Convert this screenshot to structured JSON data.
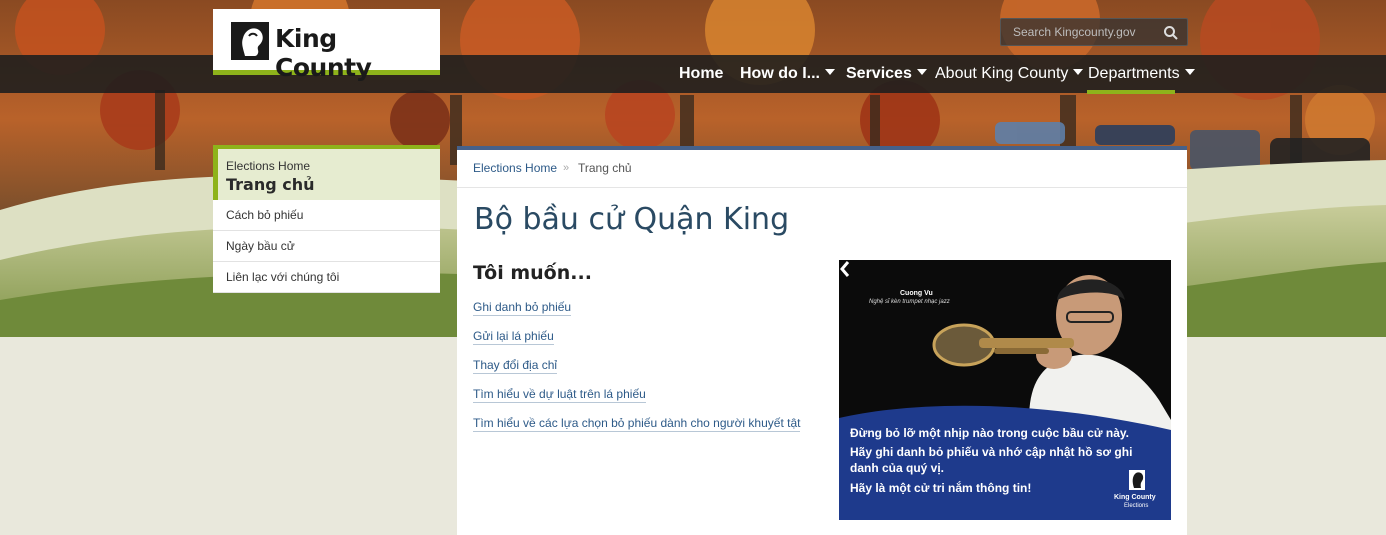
{
  "header": {
    "logo_text": "King County",
    "search_placeholder": "Search Kingcounty.gov",
    "nav": [
      {
        "label": "Home"
      },
      {
        "label": "How do I..."
      },
      {
        "label": "Services"
      },
      {
        "label": "About King County"
      },
      {
        "label": "Departments"
      }
    ]
  },
  "sidebar": {
    "parent": "Elections Home",
    "current": "Trang chủ",
    "items": [
      {
        "label": "Cách bỏ phiếu"
      },
      {
        "label": "Ngày bầu cử"
      },
      {
        "label": "Liên lạc với chúng tôi"
      }
    ]
  },
  "breadcrumb": {
    "home": "Elections Home",
    "separator": "»",
    "current": "Trang chủ"
  },
  "main": {
    "title": "Bộ bầu cử Quận King",
    "want_heading": "Tôi muốn...",
    "links": [
      {
        "label": "Ghi danh bỏ phiếu"
      },
      {
        "label": "Gửi lại lá phiếu"
      },
      {
        "label": "Thay đổi địa chỉ"
      },
      {
        "label": "Tìm hiểu về dự luật trên lá phiếu"
      },
      {
        "label": "Tìm hiểu về các lựa chọn bỏ phiếu dành cho người khuyết tật"
      }
    ]
  },
  "promo": {
    "person_name": "Cuong Vu",
    "person_role": "Nghệ sĩ kèn trumpet nhạc jazz",
    "line1": "Đừng bỏ lỡ một nhịp nào trong cuộc bầu cử này.",
    "line2": "Hãy ghi danh bỏ phiếu và nhớ cập nhật hồ sơ ghi",
    "line3": "danh của quý vị.",
    "line4": "Hãy là một cử tri nắm thông tin!",
    "logo_text": "King County",
    "logo_sub": "Elections"
  },
  "colors": {
    "accent_green": "#8eb31b",
    "link_blue": "#2d5a88",
    "title_blue": "#2a4a63",
    "promo_blue": "#1e3a8c",
    "nav_bar": "#1c1e1e"
  }
}
